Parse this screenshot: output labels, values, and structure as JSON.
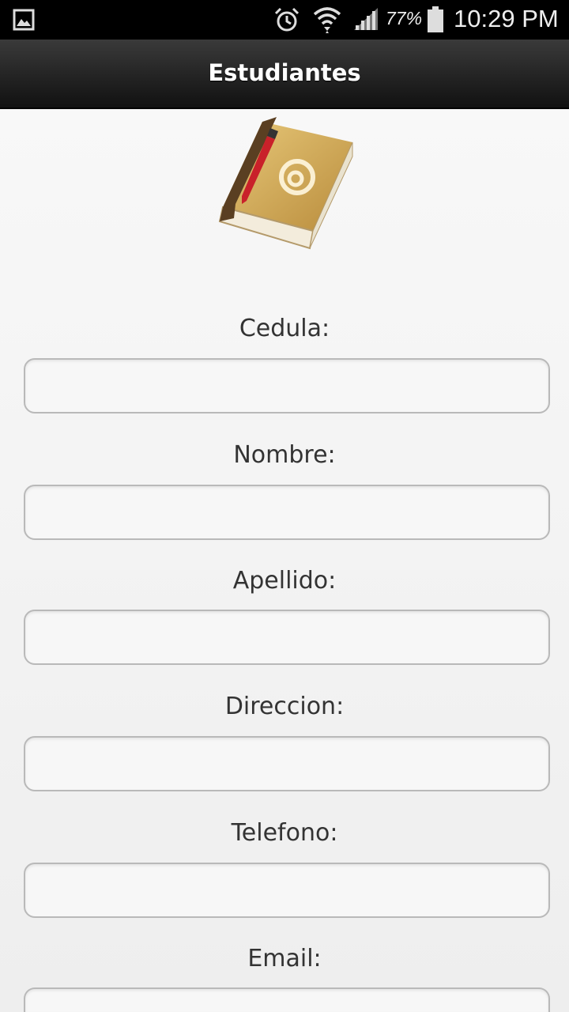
{
  "status_bar": {
    "battery_percent": "77%",
    "time": "10:29 PM",
    "icons": [
      "gallery-icon",
      "alarm-icon",
      "wifi-icon",
      "signal-icon",
      "battery-icon"
    ]
  },
  "action_bar": {
    "title": "Estudiantes"
  },
  "header_image": {
    "icon": "address-book-icon"
  },
  "form": {
    "fields": [
      {
        "label": "Cedula:",
        "value": ""
      },
      {
        "label": "Nombre:",
        "value": ""
      },
      {
        "label": "Apellido:",
        "value": ""
      },
      {
        "label": "Direccion:",
        "value": ""
      },
      {
        "label": "Telefono:",
        "value": ""
      },
      {
        "label": "Email:",
        "value": ""
      }
    ]
  },
  "colors": {
    "action_bar": "#1e1e1e",
    "status_bar": "#000000",
    "background": "#f4f4f4"
  }
}
